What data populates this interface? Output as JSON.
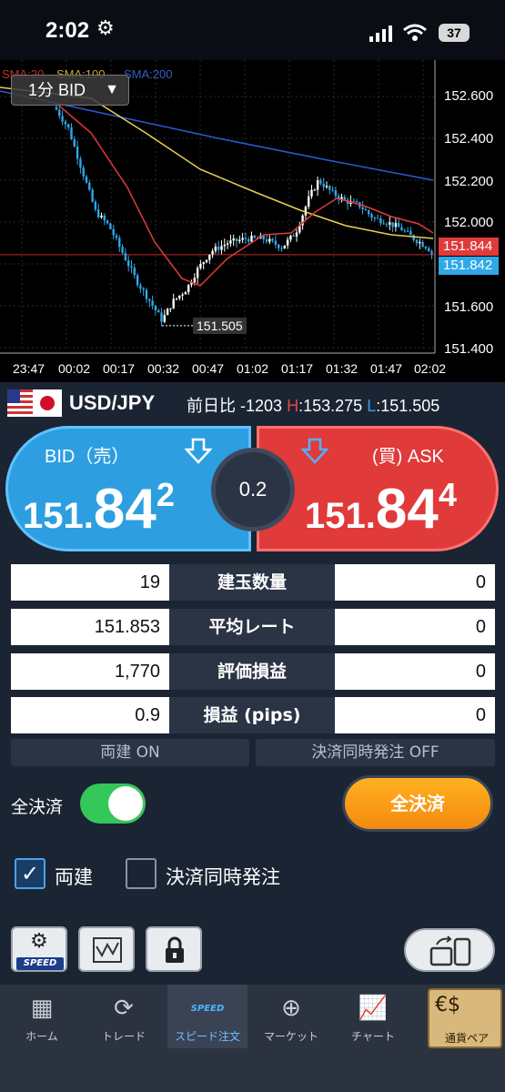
{
  "status_bar": {
    "time": "2:02",
    "settings_icon": "gear-icon",
    "battery": "37"
  },
  "chart": {
    "timeframe": "1分 BID",
    "sma_labels": [
      "SMA:20",
      "SMA:100",
      "SMA:200"
    ],
    "y_ticks": [
      "152.600",
      "152.400",
      "152.200",
      "152.000",
      "151.600",
      "151.400"
    ],
    "x_ticks": [
      "23:47",
      "00:02",
      "00:17",
      "00:32",
      "00:47",
      "01:02",
      "01:17",
      "01:32",
      "01:47",
      "02:02"
    ],
    "ask_tag": "151.844",
    "bid_tag": "151.842",
    "min_label": "151.505",
    "colors": {
      "up": "#ffffff",
      "down": "#2ea8e8",
      "sma20": "#e03a3a",
      "sma100": "#e8d050",
      "sma200": "#2a5ad8"
    }
  },
  "pair": {
    "name": "USD/JPY",
    "change_label": "前日比",
    "change_value": "-1203",
    "high_label": "H",
    "high_value": "153.275",
    "low_label": "L",
    "low_value": "151.505"
  },
  "quote": {
    "bid_label": "BID（売）",
    "bid_big1": "151.",
    "bid_big2": "84",
    "bid_big3": "2",
    "ask_label": "(買) ASK",
    "ask_big1": "151.",
    "ask_big2": "84",
    "ask_big3": "4",
    "spread": "0.2"
  },
  "positions": [
    {
      "sell": "19",
      "label": "建玉数量",
      "buy": "0"
    },
    {
      "sell": "151.853",
      "label": "平均レート",
      "buy": "0"
    },
    {
      "sell": "1,770",
      "label": "評価損益",
      "buy": "0"
    },
    {
      "sell": "0.9",
      "label": "損益 (pips)",
      "buy": "0"
    }
  ],
  "modes": {
    "hedge": "両建 ON",
    "close_order": "決済同時発注 OFF"
  },
  "settle": {
    "label": "全決済",
    "button": "全決済",
    "toggle_on": true
  },
  "options": {
    "hedge": "両建",
    "close_order": "決済同時発注"
  },
  "tools": {
    "speed_label": "SPEED"
  },
  "tabs": [
    {
      "label": "ホーム",
      "icon": "grid-icon"
    },
    {
      "label": "トレード",
      "icon": "refresh-icon"
    },
    {
      "label": "スピード注文",
      "icon": "speed-icon",
      "badge": "SPEED"
    },
    {
      "label": "マーケット",
      "icon": "globe-icon"
    },
    {
      "label": "チャート",
      "icon": "chart-icon"
    },
    {
      "label": "通貨ペア",
      "icon": "currency-icon"
    }
  ]
}
